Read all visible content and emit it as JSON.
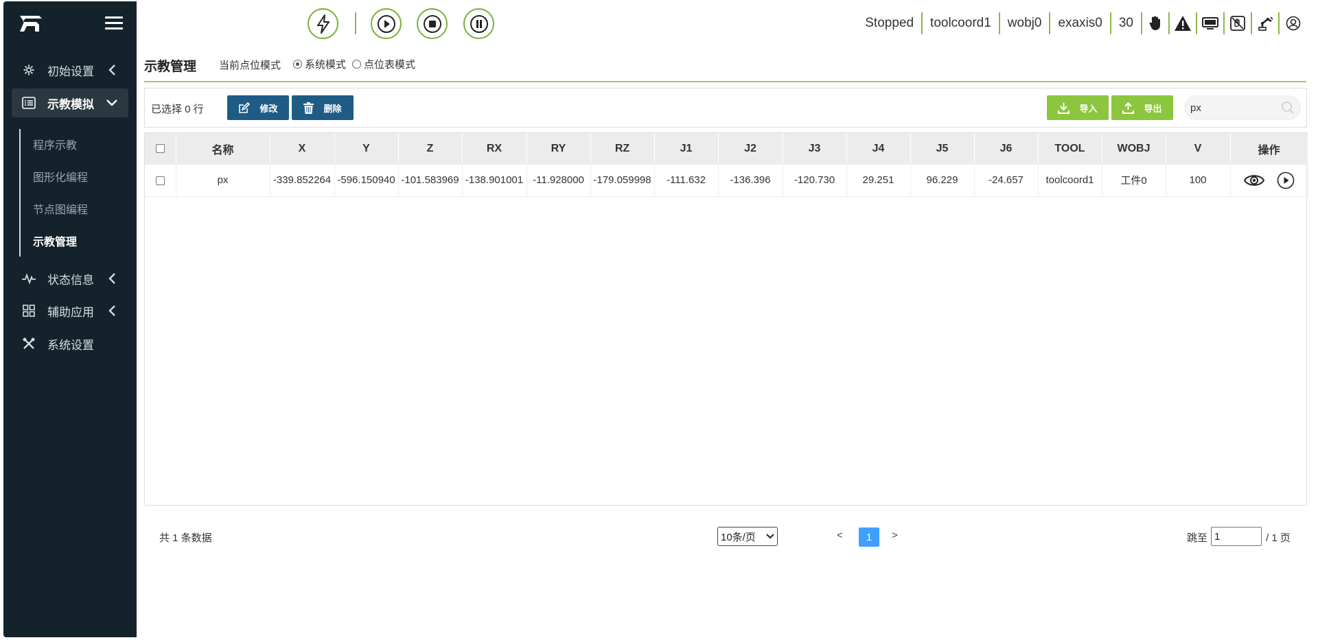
{
  "sidebar": {
    "menu": [
      {
        "label": "初始设置",
        "icon": "gear-icon"
      },
      {
        "label": "示教模拟",
        "icon": "list-icon"
      },
      {
        "label": "状态信息",
        "icon": "pulse-icon"
      },
      {
        "label": "辅助应用",
        "icon": "grid-icon"
      },
      {
        "label": "系统设置",
        "icon": "tools-icon"
      }
    ],
    "submenu": [
      {
        "label": "程序示教"
      },
      {
        "label": "图形化编程"
      },
      {
        "label": "节点图编程"
      },
      {
        "label": "示教管理"
      }
    ]
  },
  "topbar": {
    "controls": [
      "lightning-icon",
      "play-icon",
      "stop-icon",
      "pause-icon"
    ],
    "status": {
      "state": "Stopped",
      "tool": "toolcoord1",
      "wobj": "wobj0",
      "exaxis": "exaxis0",
      "speed": "30"
    },
    "icons": [
      "hand-icon",
      "warning-icon",
      "monitor-icon",
      "drag-teach-icon",
      "robot-arm-icon",
      "user-icon"
    ]
  },
  "page": {
    "title": "示教管理",
    "mode_label": "当前点位模式",
    "mode_options": [
      "系统模式",
      "点位表模式"
    ],
    "mode_selected": "系统模式"
  },
  "toolbar": {
    "selected_text": "已选择 0 行",
    "edit_label": "修改",
    "delete_label": "删除",
    "import_label": "导入",
    "export_label": "导出",
    "search_value": "px"
  },
  "table": {
    "columns": [
      "名称",
      "X",
      "Y",
      "Z",
      "RX",
      "RY",
      "RZ",
      "J1",
      "J2",
      "J3",
      "J4",
      "J5",
      "J6",
      "TOOL",
      "WOBJ",
      "V",
      "操作"
    ],
    "rows": [
      [
        "px",
        "-339.852264",
        "-596.150940",
        "-101.583969",
        "-138.901001",
        "-11.928000",
        "-179.059998",
        "-111.632",
        "-136.396",
        "-120.730",
        "29.251",
        "96.229",
        "-24.657",
        "toolcoord1",
        "工件0",
        "100"
      ]
    ]
  },
  "pager": {
    "total_text": "共 1 条数据",
    "page_size": "10条/页",
    "prev": "<",
    "next": ">",
    "current_page": "1",
    "goto_label": "跳至",
    "goto_value": "1",
    "total_pages_text": "/ 1 页"
  },
  "colors": {
    "sidebar_bg": "#14232b",
    "accent_green": "#8cc63e",
    "button_blue": "#1e5c85",
    "page_active": "#409eff"
  }
}
